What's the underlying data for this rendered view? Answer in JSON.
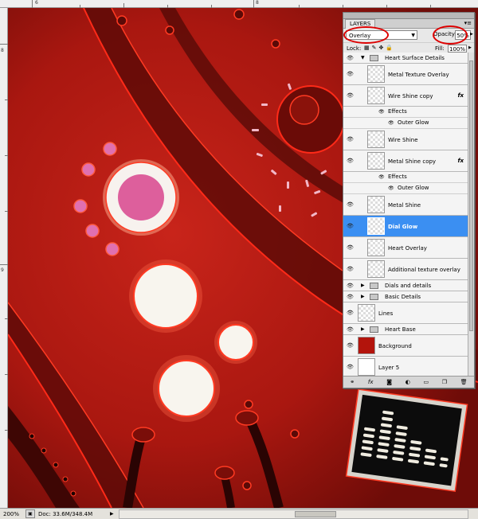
{
  "rulers": {
    "top_labels": [
      "6",
      "8"
    ],
    "left_labels": [
      "8",
      "9"
    ]
  },
  "status": {
    "zoom": "200%",
    "doc": "Doc: 33.6M/348.4M"
  },
  "layers_panel": {
    "tab": "LAYERS",
    "menu_icon": "panel-menu-icon",
    "blend_mode": "Overlay",
    "opacity_label": "Opacity:",
    "opacity": "50%",
    "lock_label": "Lock:",
    "fill_label": "Fill:",
    "fill": "100%",
    "layers": [
      {
        "name": "Heart Surface Details",
        "type": "group",
        "expanded": true
      },
      {
        "name": "Metal Texture Overlay",
        "type": "layer"
      },
      {
        "name": "Wire Shine copy",
        "type": "layer",
        "fx": "fx"
      },
      {
        "name": "Effects",
        "type": "effects"
      },
      {
        "name": "Outer Glow",
        "type": "effect"
      },
      {
        "name": "Wire Shine",
        "type": "layer"
      },
      {
        "name": "Metal Shine copy",
        "type": "layer",
        "fx": "fx"
      },
      {
        "name": "Effects",
        "type": "effects"
      },
      {
        "name": "Outer Glow",
        "type": "effect"
      },
      {
        "name": "Metal Shine",
        "type": "layer"
      },
      {
        "name": "Dial Glow",
        "type": "layer",
        "selected": true
      },
      {
        "name": "Heart Overlay",
        "type": "layer"
      },
      {
        "name": "Additional texture overlay",
        "type": "layer"
      },
      {
        "name": "Dials and details",
        "type": "group"
      },
      {
        "name": "Basic Details",
        "type": "group"
      },
      {
        "name": "Lines",
        "type": "layer"
      },
      {
        "name": "Heart Base",
        "type": "group"
      },
      {
        "name": "Background",
        "type": "layer",
        "thumb": "red"
      },
      {
        "name": "Layer 5",
        "type": "layer"
      }
    ],
    "bottom_icons": [
      "link-icon",
      "fx-icon",
      "mask-icon",
      "adjustment-icon",
      "folder-icon",
      "new-layer-icon",
      "trash-icon"
    ]
  },
  "colors": {
    "selection": "#3b8ff2",
    "annotation": "#dd0000",
    "canvas_red": "#b3140c"
  }
}
